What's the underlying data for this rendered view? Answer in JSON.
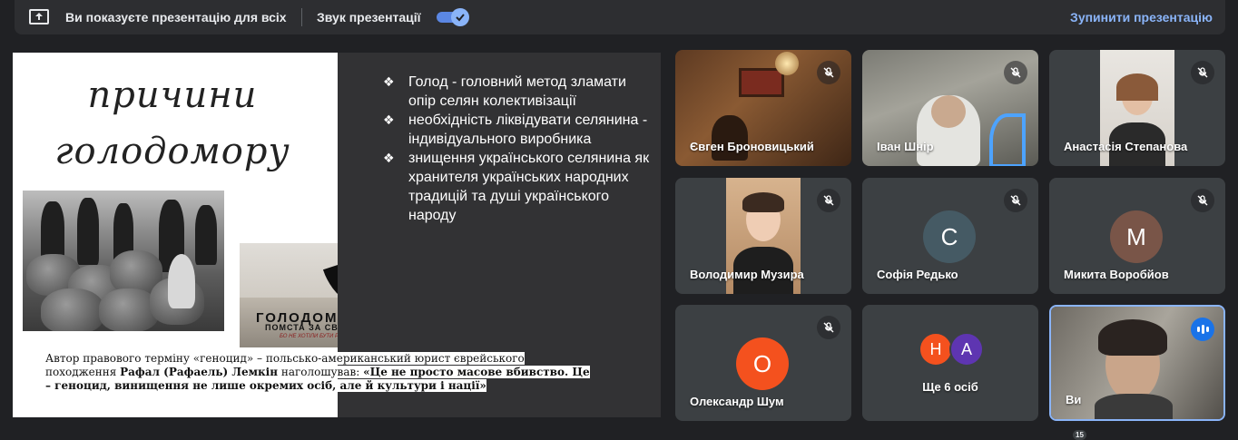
{
  "banner": {
    "presenting_text": "Ви показуєте презентацію для всіх",
    "sound_label": "Звук презентації",
    "sound_enabled": true,
    "stop_label": "Зупинити презентацію"
  },
  "slide": {
    "title_line1": "причини",
    "title_line2": "голодомору",
    "bullet_glyph": "❖",
    "bullets": [
      "Голод - головний метод зламати опір селян колективізації",
      "необхідність ліквідувати селянина - індивідуального виробника",
      "знищення українського селянина як хранителя українських народних традицій та душі українського народу"
    ],
    "poster": {
      "title": "ГОЛОДОМОР",
      "subtitle": "ПОМСТА ЗА СВОБОДУ!",
      "tagline": "БО НЕ ХОТІЛИ БУТИ РАБАМИ"
    },
    "caption": {
      "part1": "Автор правового терміну «геноцид» – польсько-американський юрист єврейського походження ",
      "name": "Рафал (Рафаель) Лемкін",
      "part2": " наголошував: ",
      "quote": "«Це не просто масове вбивство. Це – геноцид, винищення не лише окремих осіб, але й культури і нації»"
    }
  },
  "participants": [
    {
      "name": "Євген Броновицький",
      "type": "video",
      "muted": true
    },
    {
      "name": "Іван Шнір",
      "type": "video",
      "muted": true
    },
    {
      "name": "Анастасія Степанова",
      "type": "video",
      "muted": true
    },
    {
      "name": "Володимир Музира",
      "type": "video",
      "muted": true
    },
    {
      "name": "Софія Редько",
      "type": "avatar",
      "initial": "С",
      "color": "#455a64",
      "muted": true
    },
    {
      "name": "Микита Воробйов",
      "type": "avatar",
      "initial": "М",
      "color": "#795548",
      "muted": true
    },
    {
      "name": "Олександр Шум",
      "type": "avatar",
      "initial": "О",
      "color": "#f4511e",
      "muted": true
    },
    {
      "name": "Ще 6 осіб",
      "type": "group",
      "initials": [
        "Н",
        "А"
      ],
      "colors": [
        "#f4511e",
        "#5e35b1"
      ]
    },
    {
      "name": "Ви",
      "type": "self",
      "speaking": true
    }
  ],
  "badge_count": "15",
  "colors": {
    "background": "#202124",
    "tile": "#3c4043",
    "accent": "#8ab4f8",
    "active_border": "#8ab4f8"
  }
}
